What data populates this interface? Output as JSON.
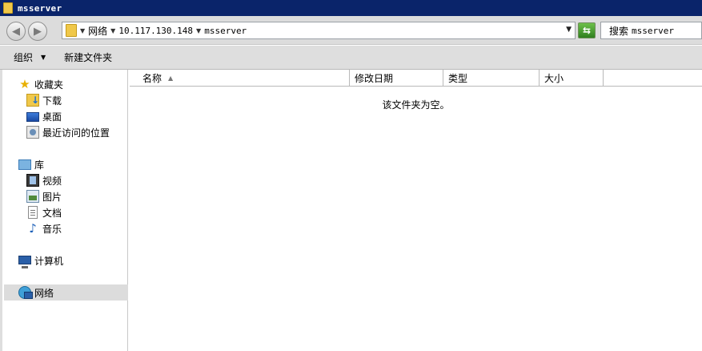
{
  "window": {
    "title": "msserver"
  },
  "address": {
    "crumbs": [
      "网络",
      "10.117.130.148",
      "msserver"
    ]
  },
  "search": {
    "label": "搜索",
    "value": "msserver"
  },
  "commands": {
    "organize": "组织",
    "new_folder": "新建文件夹"
  },
  "sidebar": {
    "favorites": {
      "label": "收藏夹",
      "items": [
        "下载",
        "桌面",
        "最近访问的位置"
      ]
    },
    "libraries": {
      "label": "库",
      "items": [
        "视频",
        "图片",
        "文档",
        "音乐"
      ]
    },
    "computer": "计算机",
    "network": "网络"
  },
  "columns": [
    "名称",
    "修改日期",
    "类型",
    "大小"
  ],
  "content": {
    "empty_message": "该文件夹为空。"
  }
}
